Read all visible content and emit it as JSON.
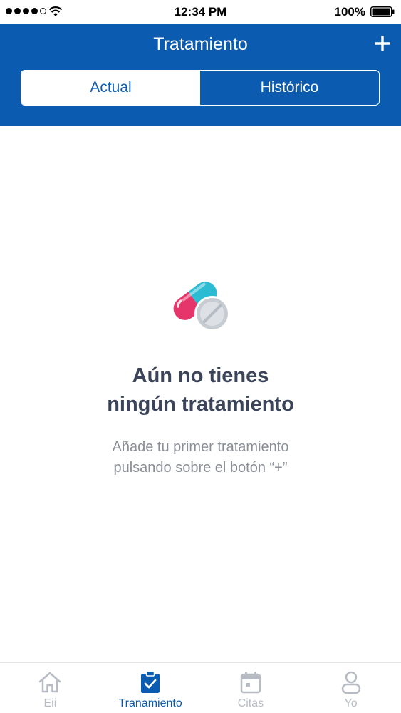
{
  "status_bar": {
    "time": "12:34 PM",
    "battery": "100%",
    "icons": [
      "signal-dots",
      "wifi-icon",
      "battery-icon"
    ]
  },
  "header": {
    "title": "Tratamiento",
    "add_label": "+",
    "segments": [
      {
        "label": "Actual",
        "selected": true
      },
      {
        "label": "Histórico",
        "selected": false
      }
    ]
  },
  "empty_state": {
    "icon": "pill-icon",
    "title_line1": "Aún no tienes",
    "title_line2": "ningún tratamiento",
    "subtitle_line1": "Añade tu primer tratamiento",
    "subtitle_line2": "pulsando sobre el botón “+”"
  },
  "tab_bar": {
    "tabs": [
      {
        "label": "Eii",
        "icon": "home-icon",
        "active": false
      },
      {
        "label": "Tranamiento",
        "icon": "clipboard-check-icon",
        "active": true
      },
      {
        "label": "Citas",
        "icon": "calendar-icon",
        "active": false
      },
      {
        "label": "Yo",
        "icon": "user-icon",
        "active": false
      }
    ]
  },
  "colors": {
    "primary": "#0b5cb1",
    "title_text": "#3b4458",
    "subtitle_text": "#8a8e96",
    "tab_inactive": "#b7bcc4",
    "pill_pink": "#e5356b",
    "pill_cyan": "#2bbcd4",
    "tablet_gray": "#c7ccd2"
  }
}
